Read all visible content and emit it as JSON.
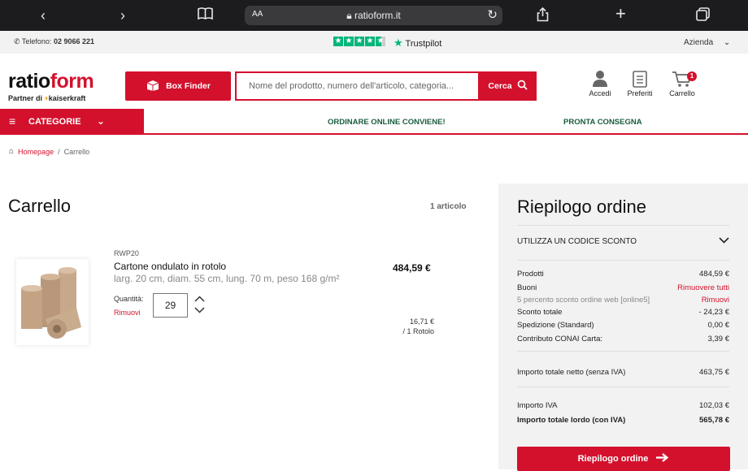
{
  "browser": {
    "text_size_label": "AA",
    "url": "ratioform.it"
  },
  "topbar": {
    "phone_label": "Telefono:",
    "phone_number": "02 9066 221",
    "trustpilot": "Trustpilot",
    "azienda": "Azienda"
  },
  "header": {
    "logo_ratio": "ratio",
    "logo_form": "form",
    "partner_label": "Partner di",
    "partner_brand": "kaiserkraft",
    "box_finder": "Box Finder",
    "search_placeholder": "Nome del prodotto, numero dell'articolo, categoria...",
    "search_button": "Cerca",
    "account": "Accedi",
    "favorites": "Preferiti",
    "cart": "Carrello",
    "cart_badge": "1"
  },
  "nav": {
    "categories": "CATEGORIE",
    "link1": "ORDINARE ONLINE CONVIENE!",
    "link2": "PRONTA CONSEGNA"
  },
  "breadcrumb": {
    "home": "Homepage",
    "separator": "/",
    "current": "Carrello"
  },
  "cart": {
    "title": "Carrello",
    "count": "1 articolo",
    "item": {
      "sku": "RWP20",
      "name": "Cartone ondulato in rotolo",
      "description": "larg. 20 cm, diam. 55 cm, lung. 70 m, peso 168 g/m²",
      "qty_label": "Quantità:",
      "quantity": "29",
      "remove": "Rimuovi",
      "price": "484,59 €",
      "unit_price": "16,71 €",
      "unit": "/ 1 Rotolo"
    }
  },
  "summary": {
    "title": "Riepilogo ordine",
    "coupon": "UTILIZZA UN CODICE SCONTO",
    "rows": {
      "products_label": "Prodotti",
      "products_value": "484,59 €",
      "vouchers_label": "Buoni",
      "vouchers_action": "Rimuovere tutti",
      "discount_desc": "5 percento sconto ordine web [online5]",
      "discount_remove": "Rimuovi",
      "total_discount_label": "Sconto totale",
      "total_discount_value": "- 24,23 €",
      "shipping_label": "Spedizione (Standard)",
      "shipping_value": "0,00 €",
      "conai_label": "Contributo CONAI Carta:",
      "conai_value": "3,39 €",
      "net_label": "Importo totale netto (senza IVA)",
      "net_value": "463,75 €",
      "vat_label": "Importo IVA",
      "vat_value": "102,03 €",
      "gross_label": "Importo totale lordo (con IVA)",
      "gross_value": "565,78 €"
    },
    "checkout": "Riepilogo ordine"
  },
  "colors": {
    "brand_red": "#d3112d",
    "trustpilot_green": "#00b67a",
    "nav_green": "#1a5c3e"
  }
}
